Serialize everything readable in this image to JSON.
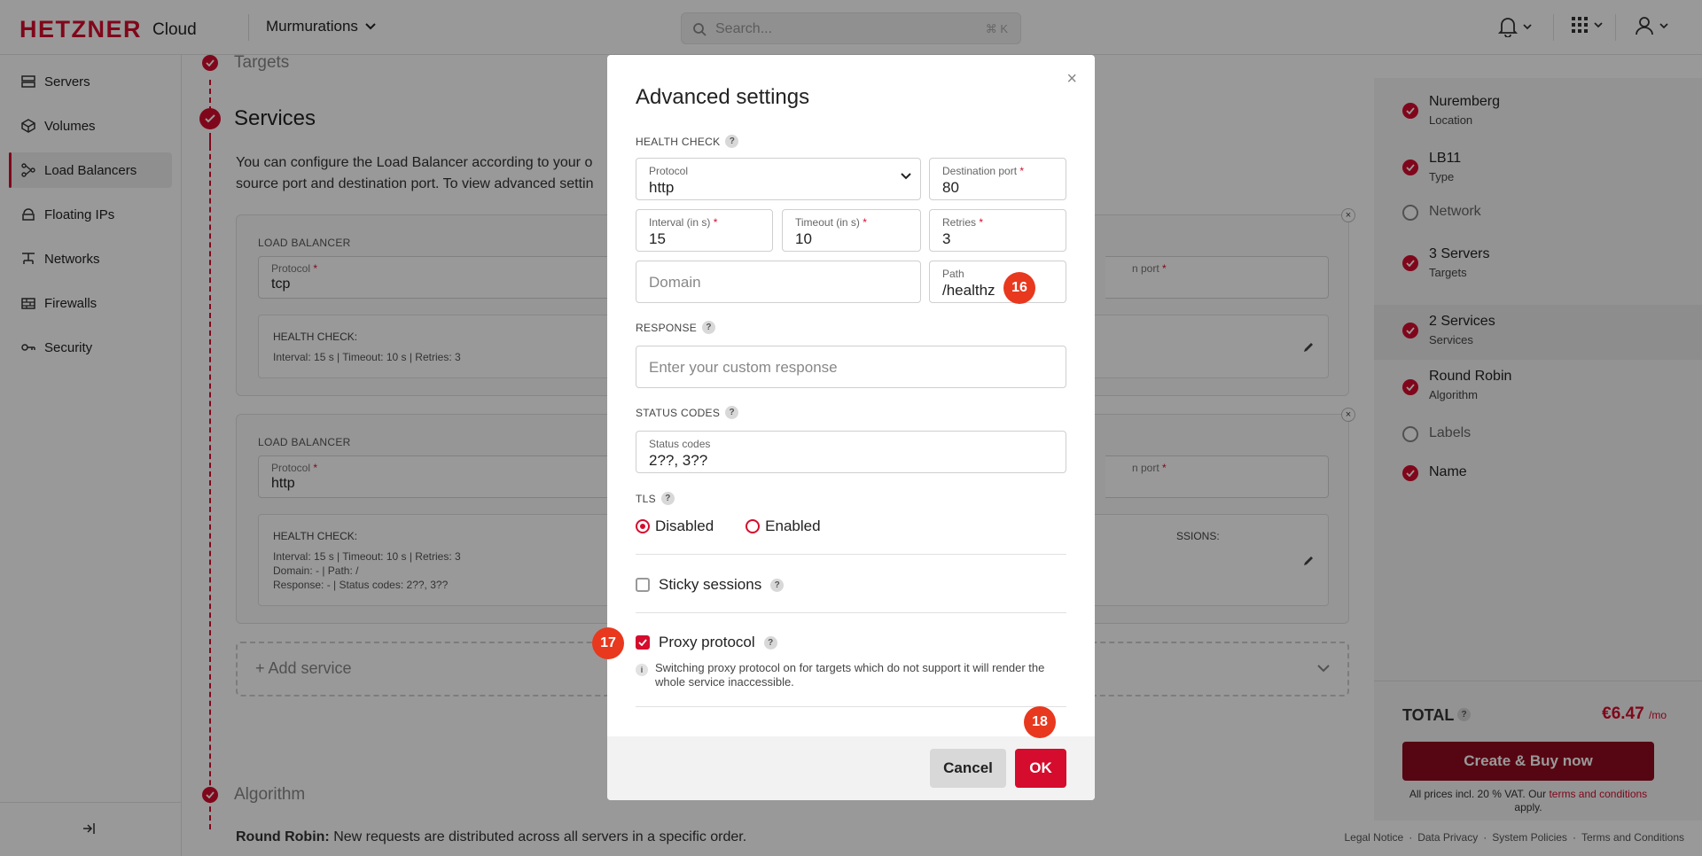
{
  "topbar": {
    "logo_word": "HETZNER",
    "logo_cloud": "Cloud",
    "project": "Murmurations",
    "search_placeholder": "Search...",
    "search_shortcut": "⌘ K"
  },
  "sidebar": {
    "items": [
      {
        "label": "Servers",
        "icon": "server-icon"
      },
      {
        "label": "Volumes",
        "icon": "volume-icon"
      },
      {
        "label": "Load Balancers",
        "icon": "load-balancer-icon",
        "active": true
      },
      {
        "label": "Floating IPs",
        "icon": "floating-ip-icon"
      },
      {
        "label": "Networks",
        "icon": "network-icon"
      },
      {
        "label": "Firewalls",
        "icon": "firewall-icon"
      },
      {
        "label": "Security",
        "icon": "key-icon"
      }
    ]
  },
  "main": {
    "targets_title": "Targets",
    "services_title": "Services",
    "services_desc_1": "You can configure the Load Balancer according to your o",
    "services_desc_2": "source port and destination port. To view advanced settin",
    "services": [
      {
        "section": "LOAD BALANCER",
        "protocol_label": "Protocol",
        "protocol_value": "tcp",
        "port_label": "n port",
        "hc_title": "HEALTH CHECK:",
        "hc_line1": "Interval: 15 s | Timeout: 10 s | Retries: 3"
      },
      {
        "section": "LOAD BALANCER",
        "protocol_label": "Protocol",
        "protocol_value": "http",
        "port_label": "n port",
        "hc_title": "HEALTH CHECK:",
        "hc_line1": "Interval: 15 s | Timeout: 10 s | Retries: 3",
        "hc_line2": "Domain: -  | Path: /",
        "hc_line3": "Response: -  | Status codes: 2??, 3??",
        "sessions_label": "SSIONS:"
      }
    ],
    "add_service": "+ Add service",
    "algorithm_title": "Algorithm",
    "algo_rr_bold": "Round Robin:",
    "algo_rr_text": " New requests are distributed across all servers in a specific order."
  },
  "summary": {
    "items": [
      {
        "title": "Nuremberg",
        "sub": "Location",
        "done": true
      },
      {
        "title": "LB11",
        "sub": "Type",
        "done": true
      },
      {
        "title": "Network",
        "sub": "",
        "done": false
      },
      {
        "title": "3 Servers",
        "sub": "Targets",
        "done": true
      },
      {
        "title": "2 Services",
        "sub": "Services",
        "done": true,
        "active": true
      },
      {
        "title": "Round Robin",
        "sub": "Algorithm",
        "done": true
      },
      {
        "title": "Labels",
        "sub": "",
        "done": false
      },
      {
        "title": "Name",
        "sub": "",
        "done": true
      }
    ],
    "total_label": "TOTAL",
    "total_price": "€6.47",
    "total_unit": "/mo",
    "buy_button": "Create & Buy now",
    "vat_text": "All prices incl. 20 % VAT. Our ",
    "vat_link": "terms and conditions",
    "vat_end": " apply."
  },
  "footer": {
    "links": [
      "Legal Notice",
      "Data Privacy",
      "System Policies",
      "Terms and Conditions"
    ]
  },
  "modal": {
    "title": "Advanced settings",
    "health_check_label": "HEALTH CHECK",
    "protocol_label": "Protocol",
    "protocol_value": "http",
    "dest_port_label": "Destination port",
    "dest_port_value": "80",
    "interval_label": "Interval (in s)",
    "interval_value": "15",
    "timeout_label": "Timeout (in s)",
    "timeout_value": "10",
    "retries_label": "Retries",
    "retries_value": "3",
    "domain_placeholder": "Domain",
    "path_label": "Path",
    "path_value": "/healthz",
    "response_label": "RESPONSE",
    "response_placeholder": "Enter your custom response",
    "status_codes_section": "STATUS CODES",
    "status_codes_label": "Status codes",
    "status_codes_value": "2??, 3??",
    "tls_label": "TLS",
    "tls_disabled": "Disabled",
    "tls_enabled": "Enabled",
    "sticky_label": "Sticky sessions",
    "proxy_label": "Proxy protocol",
    "proxy_checked": true,
    "proxy_info": "Switching proxy protocol on for targets which do not support it will render the whole service inaccessible.",
    "cancel": "Cancel",
    "ok": "OK"
  },
  "markers": {
    "m16": "16",
    "m17": "17",
    "m18": "18"
  },
  "colors": {
    "brand": "#d50c2d",
    "marker": "#e8381e"
  }
}
